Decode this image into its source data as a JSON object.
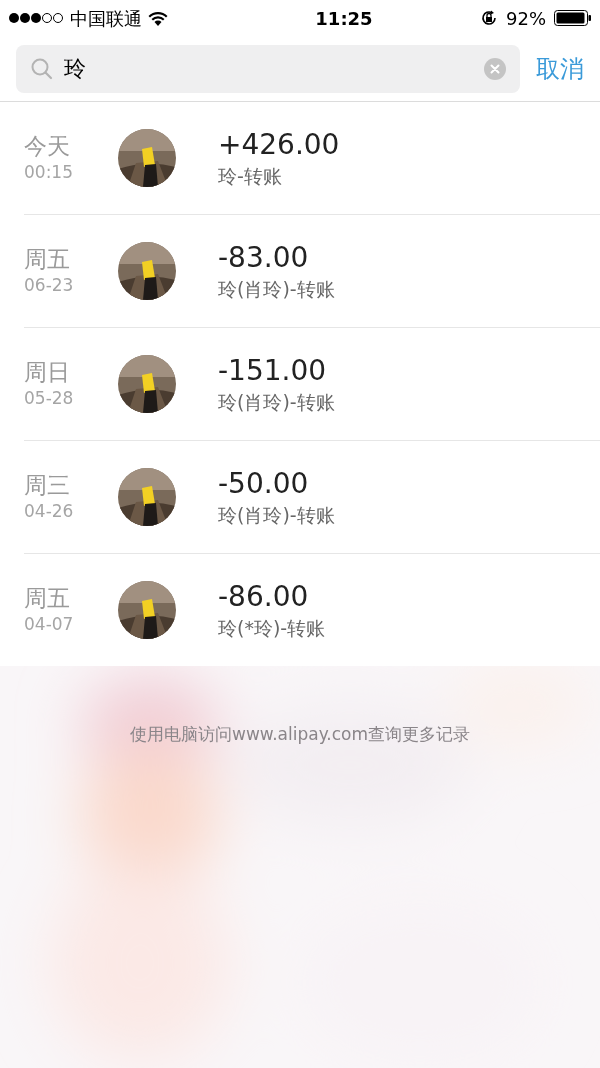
{
  "status_bar": {
    "carrier": "中国联通",
    "time": "11:25",
    "battery": "92%"
  },
  "search": {
    "value": "玲",
    "cancel": "取消"
  },
  "records": [
    {
      "day": "今天",
      "time": "00:15",
      "amount": "+426.00",
      "desc": "玲-转账"
    },
    {
      "day": "周五",
      "time": "06-23",
      "amount": "-83.00",
      "desc": "玲(肖玲)-转账"
    },
    {
      "day": "周日",
      "time": "05-28",
      "amount": "-151.00",
      "desc": "玲(肖玲)-转账"
    },
    {
      "day": "周三",
      "time": "04-26",
      "amount": "-50.00",
      "desc": "玲(肖玲)-转账"
    },
    {
      "day": "周五",
      "time": "04-07",
      "amount": "-86.00",
      "desc": "玲(*玲)-转账"
    }
  ],
  "footer": "使用电脑访问www.alipay.com查询更多记录"
}
